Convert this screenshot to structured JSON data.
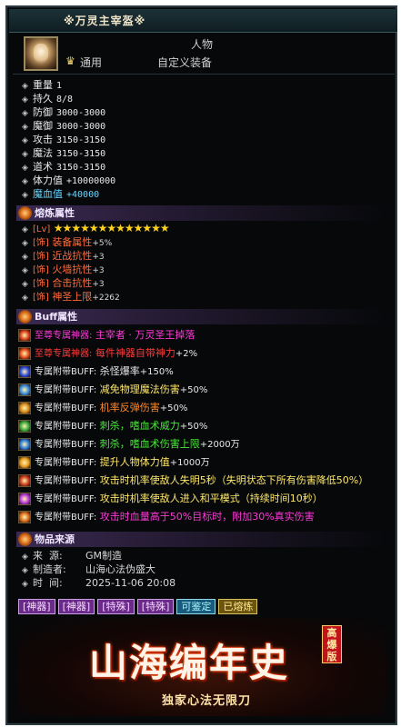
{
  "item": {
    "title": "※万灵主宰盔※",
    "category": "人物",
    "binding": "通用",
    "equip_type": "自定义装备"
  },
  "stats": [
    {
      "name": "重量",
      "value": "1"
    },
    {
      "name": "持久",
      "value": "8/8"
    },
    {
      "name": "防御",
      "value": "3000-3000"
    },
    {
      "name": "魔御",
      "value": "3000-3000"
    },
    {
      "name": "攻击",
      "value": "3150-3150"
    },
    {
      "name": "魔法",
      "value": "3150-3150"
    },
    {
      "name": "道术",
      "value": "3150-3150"
    },
    {
      "name": "体力值",
      "value": "+10000000"
    },
    {
      "name": "魔血值",
      "value": "+40000"
    }
  ],
  "refine": {
    "header": "熔炼属性",
    "level_tag": "[Lv]",
    "stars": "★★★★★★★★★★★★★",
    "rows": [
      {
        "tag": "[饰]",
        "name": "装备属性",
        "value": "+5%"
      },
      {
        "tag": "[饰]",
        "name": "近战抗性",
        "value": "+3"
      },
      {
        "tag": "[饰]",
        "name": "火墙抗性",
        "value": "+3"
      },
      {
        "tag": "[饰]",
        "name": "合击抗性",
        "value": "+3"
      },
      {
        "tag": "[饰]",
        "name": "神圣上限",
        "value": "+2262"
      }
    ]
  },
  "buff": {
    "header": "Buff属性",
    "rows": [
      {
        "prefix": "至尊专属神器:",
        "desc": "主宰者 · 万灵圣王掉落",
        "color": "#ff3ad8",
        "prefix_color": "#ff3ad8",
        "icon_color": "#d8401a"
      },
      {
        "prefix": "至尊专属神器:",
        "desc": "每件神器自带神力",
        "extra": "+2%",
        "color": "#ff3a3a",
        "prefix_color": "#ff3a3a",
        "icon_color": "#e04a1a"
      },
      {
        "prefix": "专属附带BUFF:",
        "desc": "杀怪爆率",
        "extra": "+150%",
        "color": "#e8e8e8",
        "prefix_color": "#e8e8e8",
        "icon_color": "#2a4ad8"
      },
      {
        "prefix": "专属附带BUFF:",
        "desc": "减免物理魔法伤害",
        "extra": "+50%",
        "color": "#ffe86a",
        "prefix_color": "#e8e8e8",
        "icon_color": "#3a8ad8"
      },
      {
        "prefix": "专属附带BUFF:",
        "desc": "机率反弹伤害",
        "extra": "+50%",
        "color": "#ff8a2a",
        "prefix_color": "#e8e8e8",
        "icon_color": "#d88a1a"
      },
      {
        "prefix": "专属附带BUFF:",
        "desc": "刺杀，嗜血术威力",
        "extra": "+50%",
        "color": "#4ae83a",
        "prefix_color": "#e8e8e8",
        "icon_color": "#3aa83a"
      },
      {
        "prefix": "专属附带BUFF:",
        "desc": "刺杀，嗜血术伤害上限",
        "extra": "+2000万",
        "color": "#4ae83a",
        "prefix_color": "#e8e8e8",
        "icon_color": "#2a7ad8"
      },
      {
        "prefix": "专属附带BUFF:",
        "desc": "提升人物体力值",
        "extra": "+1000万",
        "color": "#ffe86a",
        "prefix_color": "#e8e8e8",
        "icon_color": "#e89a1a"
      },
      {
        "prefix": "专属附带BUFF:",
        "desc": "攻击时机率使敌人失明5秒（失明状态下所有伤害降低50%）",
        "color": "#ffe86a",
        "prefix_color": "#e8e8e8",
        "icon_color": "#c83a1a"
      },
      {
        "prefix": "专属附带BUFF:",
        "desc": "攻击时机率使敌人进入和平模式（持续时间10秒）",
        "color": "#ffe86a",
        "prefix_color": "#e8e8e8",
        "icon_color": "#b83ad8"
      },
      {
        "prefix": "专属附带BUFF:",
        "desc": "攻击时血量高于50%目标时，附加30%真实伤害",
        "color": "#ff3ad8",
        "prefix_color": "#e8e8e8",
        "icon_color": "#d86a1a"
      }
    ]
  },
  "source": {
    "header": "物品来源",
    "rows": [
      {
        "label": "来  源:",
        "value": "GM制造"
      },
      {
        "label": "制造者:",
        "value": "山海心法伪盛大"
      },
      {
        "label": "时  间:",
        "value": "2025-11-06 20:08"
      }
    ]
  },
  "buttons": [
    {
      "label": "[神器]",
      "style": "purple"
    },
    {
      "label": "[神器]",
      "style": "purple"
    },
    {
      "label": "[特殊]",
      "style": "purple"
    },
    {
      "label": "[特殊]",
      "style": "purple"
    },
    {
      "label": "可鉴定",
      "style": "blue"
    },
    {
      "label": "已熔炼",
      "style": "gold"
    }
  ],
  "banner": {
    "title": "山海编年史",
    "badge": "高爆版",
    "subtitle": "独家心法无限刀"
  },
  "colors": {
    "refine_red": "#ff6a3a",
    "mana_cyan": "#66d6ff",
    "star_gold": "#ffd21c"
  }
}
